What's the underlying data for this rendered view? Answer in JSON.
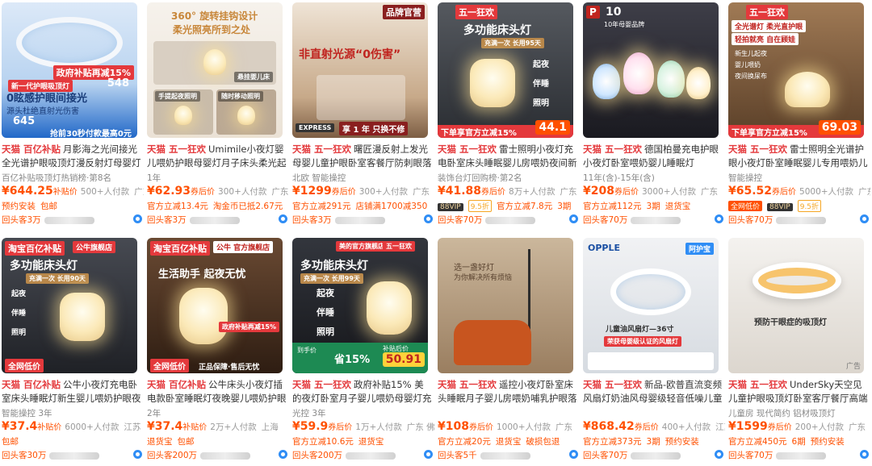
{
  "products": [
    {
      "thumb": {
        "colors": [
          "#cfe3f7",
          "#2168c8"
        ],
        "texts": [
          "0眩感护眼间接光",
          "源头杜绝直射光伤害",
          "抢前30秒付款最高0元"
        ],
        "badges": [
          "政府补贴再减15%",
          "新一代护眼吸顶灯"
        ],
        "prices": [
          "548",
          "645"
        ]
      },
      "tag": "天猫 百亿补贴",
      "title": "月影海之光间接光全光谱护眼吸顶灯漫反射灯母婴灯儿...",
      "sub": "百亿补贴吸顶灯热销榜·第8名",
      "price": "¥644.25",
      "price_label": "补贴价",
      "meta": [
        "500+人付款",
        "广东"
      ],
      "promo": [
        "预约安装",
        "包邮"
      ],
      "shop": "回头客3万"
    },
    {
      "thumb": {
        "colors": [
          "#f3efe9",
          "#e7ddd1"
        ],
        "texts": [
          "360° 旋转挂钩设计",
          "柔光照亮所到之处",
          "悬挂婴儿床",
          "手提起夜照明",
          "随时移动照明"
        ],
        "badges": [],
        "prices": []
      },
      "tag": "天猫 五一狂欢",
      "title": "Umimile小夜灯婴儿喂奶护眼母婴灯月子床头柔光起夜...",
      "sub": "1年",
      "price": "¥62.93",
      "price_label": "券后价",
      "meta": [
        "300+人付款",
        "广东"
      ],
      "promo": [
        "官方立减13.4元",
        "淘金币已抵2.67元"
      ],
      "shop": "回头客3万"
    },
    {
      "thumb": {
        "colors": [
          "#e9d8c8",
          "#b89a80"
        ],
        "texts": [
          "非直射光源“0伤害”",
          "EXPRESS",
          "享 1 年 只换不修"
        ],
        "badges": [
          "品牌官营"
        ],
        "prices": []
      },
      "tag": "天猫 五一狂欢",
      "title": "曙匠漫反射上发光 母婴儿童护眼卧室客餐厅防刺眼落地...",
      "sub": "北欧 智能操控",
      "price": "¥1299",
      "price_label": "券后价",
      "meta": [
        "300+人付款",
        "广东"
      ],
      "promo": [
        "官方立减291元",
        "店铺满1700减350"
      ],
      "shop": "回头客3万"
    },
    {
      "thumb": {
        "colors": [
          "#4a4f57",
          "#1e2126"
        ],
        "texts": [
          "多功能床头灯",
          "充满一次 长用95天",
          "起夜",
          "伴睡",
          "照明",
          "下单享官方立减15%"
        ],
        "badges": [
          "五一狂欢"
        ],
        "prices": [
          "44.1"
        ]
      },
      "tag": "天猫 五一狂欢",
      "title": "雷士照明小夜灯充电卧室床头睡眠婴儿房喂奶夜间新生...",
      "sub": "装饰台灯回购榜·第2名",
      "price": "¥41.88",
      "price_label": "券后价",
      "meta": [
        "8万+人付款",
        "广东"
      ],
      "promo": [
        "88VIP",
        "9.5折",
        "官方立减7.8元",
        "3期"
      ],
      "shop": "回头客70万"
    },
    {
      "thumb": {
        "colors": [
          "#3a3a44",
          "#15151b"
        ],
        "texts": [
          "10",
          "10年母婴品牌"
        ],
        "badges": [],
        "prices": []
      },
      "tag": "天猫 五一狂欢",
      "title": "德国柏曼充电护眼小夜灯卧室喂奶婴儿睡眠灯",
      "sub": "11年(含)-15年(含)",
      "price": "¥208",
      "price_label": "券后价",
      "meta": [
        "3000+人付款",
        "广东"
      ],
      "promo": [
        "官方立减112元",
        "3期",
        "退货宝"
      ],
      "shop": "回头客70万"
    },
    {
      "thumb": {
        "colors": [
          "#8a6a4a",
          "#4a3220"
        ],
        "texts": [
          "全光谱灯 柔光直护眼",
          "轻拍就亮 自在顾娃",
          "新生儿起夜",
          "婴儿喂奶",
          "夜间换尿布",
          "下单享官方立减15%"
        ],
        "badges": [
          "五一狂欢"
        ],
        "prices": [
          "69.03"
        ]
      },
      "tag": "天猫 五一狂欢",
      "title": "雷士照明全光谱护眼小夜灯卧室睡眠婴儿专用喂奶儿童...",
      "sub": "智能操控",
      "price": "¥65.52",
      "price_label": "券后价",
      "meta": [
        "5000+人付款",
        "广东"
      ],
      "promo": [
        "全网低价",
        "88VIP",
        "9.5折"
      ],
      "shop": "回头客70万"
    },
    {
      "thumb": {
        "colors": [
          "#3d3f47",
          "#1b1c21"
        ],
        "texts": [
          "多功能床头灯",
          "充满一次 长用90天",
          "起夜",
          "伴睡",
          "照明",
          "全网低价"
        ],
        "badges": [
          "淘宝百亿补贴",
          "公牛旗舰店"
        ],
        "prices": []
      },
      "tag": "天猫 百亿补贴",
      "title": "公牛小夜灯充电卧室床头睡眠灯新生婴儿喂奶护眼夜间...",
      "sub": "智能操控 3年",
      "price": "¥37.4",
      "price_label": "补贴价",
      "meta": [
        "6000+人付款",
        "江苏"
      ],
      "promo": [
        "包邮"
      ],
      "shop": "回头客30万"
    },
    {
      "thumb": {
        "colors": [
          "#5a3d2a",
          "#2a1a10"
        ],
        "texts": [
          "生活助手 起夜无忧",
          "政府补贴再减15%",
          "正品保障·售后无忧"
        ],
        "badges": [
          "淘宝百亿补贴",
          "公牛 官方旗舰店"
        ],
        "prices": []
      },
      "tag": "天猫 百亿补贴",
      "title": "公牛床头小夜灯插电款卧室睡眠灯夜晚婴儿喂奶护眼灯...",
      "sub": "2年",
      "price": "¥37.4",
      "price_label": "补贴价",
      "meta": [
        "2万+人付款",
        "上海"
      ],
      "promo": [
        "退货宝",
        "包邮"
      ],
      "shop": "回头客200万"
    },
    {
      "thumb": {
        "colors": [
          "#2b2d33",
          "#121317"
        ],
        "texts": [
          "多功能床头灯",
          "充满一次 长用99天",
          "起夜",
          "伴睡",
          "照明",
          "到手价",
          "省15%",
          "补贴后价"
        ],
        "badges": [
          "美的官方旗舰店",
          "五一狂欢"
        ],
        "prices": [
          "50.91"
        ]
      },
      "tag": "天猫 五一狂欢",
      "title": "政府补贴15% 美的夜灯卧室月子婴儿喂奶母婴灯充电床...",
      "sub": "光控 3年",
      "price": "¥59.9",
      "price_label": "券后价",
      "meta": [
        "1万+人付款",
        "广东 佛山"
      ],
      "promo": [
        "官方立减10.6元",
        "退货宝"
      ],
      "shop": "回头客200万"
    },
    {
      "thumb": {
        "colors": [
          "#c9b59a",
          "#8a6f52"
        ],
        "texts": [
          "选一盏好灯",
          "为你解决所有烦恼"
        ],
        "badges": [],
        "prices": []
      },
      "tag": "天猫 五一狂欢",
      "title": "遥控小夜灯卧室床头睡眠月子婴儿房喂奶哺乳护眼落地...",
      "sub": "",
      "price": "¥108",
      "price_label": "券后价",
      "meta": [
        "1000+人付款",
        "广东"
      ],
      "promo": [
        "官方立减20元",
        "退货宝",
        "破损包退"
      ],
      "shop": "回头客5千"
    },
    {
      "thumb": {
        "colors": [
          "#eef0f2",
          "#cfd5dc"
        ],
        "texts": [
          "OPPLE",
          "儿童油风扇灯—36寸",
          "荣获母婴级认证的风扇灯"
        ],
        "badges": [
          "阿护宝"
        ],
        "prices": []
      },
      "tag": "天猫 五一狂欢",
      "title": "新品-欧普直流变频风扇灯奶油风母婴级轻音低噪儿童房...",
      "sub": "",
      "price": "¥868.42",
      "price_label": "券后价",
      "meta": [
        "400+人付款",
        "江苏"
      ],
      "promo": [
        "官方立减373元",
        "3期",
        "预约安装"
      ],
      "shop": "回头客70万"
    },
    {
      "thumb": {
        "colors": [
          "#f1efec",
          "#d9d4cd"
        ],
        "texts": [
          "预防干眼症的吸顶灯"
        ],
        "badges": [],
        "prices": []
      },
      "tag": "天猫 五一狂欢",
      "title": "UnderSky天空见 儿童护眼吸顶灯卧室客厅餐厅高端l...",
      "sub": "儿童房 现代简约 铝材吸顶灯",
      "price": "¥1599",
      "price_label": "券后价",
      "meta": [
        "200+人付款",
        "广东"
      ],
      "promo": [
        "官方立减450元",
        "6期",
        "预约安装"
      ],
      "shop": "回头客70万"
    }
  ],
  "ad_label": "广告"
}
